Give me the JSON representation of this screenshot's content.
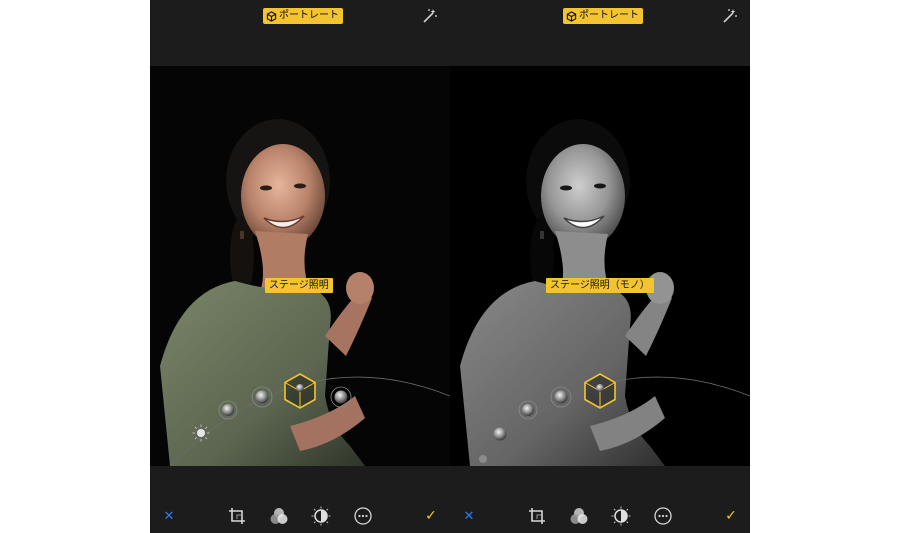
{
  "colors": {
    "accent_yellow": "#f4c430",
    "cancel_blue": "#3478f6",
    "toolbar_bg": "#1c1c1c"
  },
  "panels": [
    {
      "id": "left",
      "mode_badge": "ポートレート",
      "lighting_label": "ステージ照明",
      "lighting_mode": "stage",
      "cancel_label": "✕",
      "done_label": "✓",
      "tools": [
        "crop-icon",
        "filters-icon",
        "adjust-icon",
        "more-icon"
      ]
    },
    {
      "id": "right",
      "mode_badge": "ポートレート",
      "lighting_label": "ステージ照明（モノ）",
      "lighting_mode": "stage-mono",
      "cancel_label": "✕",
      "done_label": "✓",
      "tools": [
        "crop-icon",
        "filters-icon",
        "adjust-icon",
        "more-icon"
      ]
    }
  ]
}
